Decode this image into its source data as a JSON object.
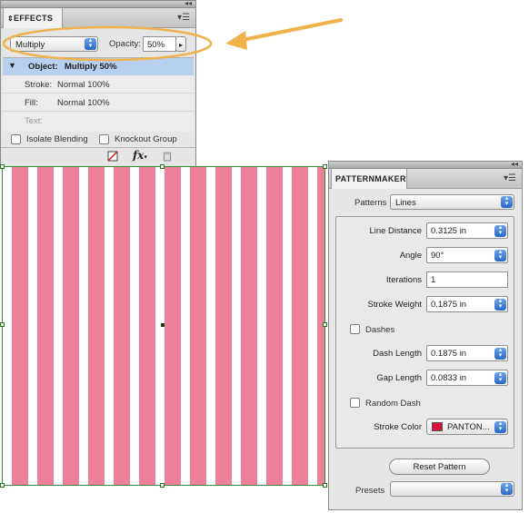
{
  "effects": {
    "tab": "EFFECTS",
    "blend_mode": "Multiply",
    "opacity_label": "Opacity:",
    "opacity_value": "50%",
    "rows": [
      {
        "label": "Object:",
        "value": "Multiply 50%"
      },
      {
        "label": "Stroke:",
        "value": "Normal 100%"
      },
      {
        "label": "Fill:",
        "value": "Normal 100%"
      },
      {
        "label": "Text:",
        "value": ""
      }
    ],
    "isolate_label": "Isolate Blending",
    "knockout_label": "Knockout Group"
  },
  "patternmaker": {
    "tab": "PATTERNMAKER",
    "patterns_label": "Patterns",
    "patterns_value": "Lines",
    "fields": {
      "line_distance": {
        "label": "Line Distance",
        "value": "0.3125 in"
      },
      "angle": {
        "label": "Angle",
        "value": "90°"
      },
      "iterations": {
        "label": "Iterations",
        "value": "1"
      },
      "stroke_weight": {
        "label": "Stroke Weight",
        "value": "0.1875 in"
      },
      "dash_length": {
        "label": "Dash Length",
        "value": "0.1875 in"
      },
      "gap_length": {
        "label": "Gap Length",
        "value": "0.0833 in"
      },
      "stroke_color": {
        "label": "Stroke Color",
        "value": "PANTON..."
      }
    },
    "dashes_label": "Dashes",
    "random_dash_label": "Random Dash",
    "reset_label": "Reset Pattern",
    "presets_label": "Presets",
    "presets_value": ""
  },
  "colors": {
    "stripe_pink": "#ee8199",
    "stroke_swatch": "#d7133d",
    "annotation_orange": "#f0b24a",
    "selection_blue": "#b8d0f0"
  }
}
